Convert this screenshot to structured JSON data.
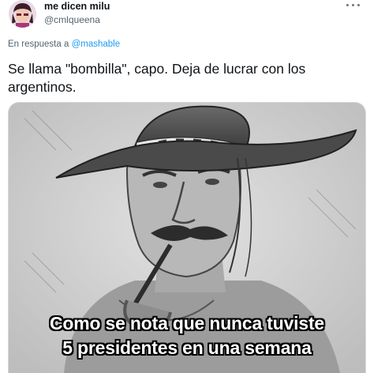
{
  "author": {
    "display_name": "me dicen milu",
    "handle": "@cmlqueena",
    "avatar_icon": "avatar-icon"
  },
  "reply_context": {
    "prefix": "En respuesta a",
    "mention": "@mashable"
  },
  "tweet": {
    "text": "Se llama \"bombilla\", capo. Deja de lucrar con los argentinos."
  },
  "media": {
    "caption_line1": "Como se nota que nunca tuviste",
    "caption_line2": "5 presidentes en una semana"
  },
  "colors": {
    "link": "#1d9bf0",
    "secondary_text": "#536471",
    "border": "#cfd9de"
  }
}
